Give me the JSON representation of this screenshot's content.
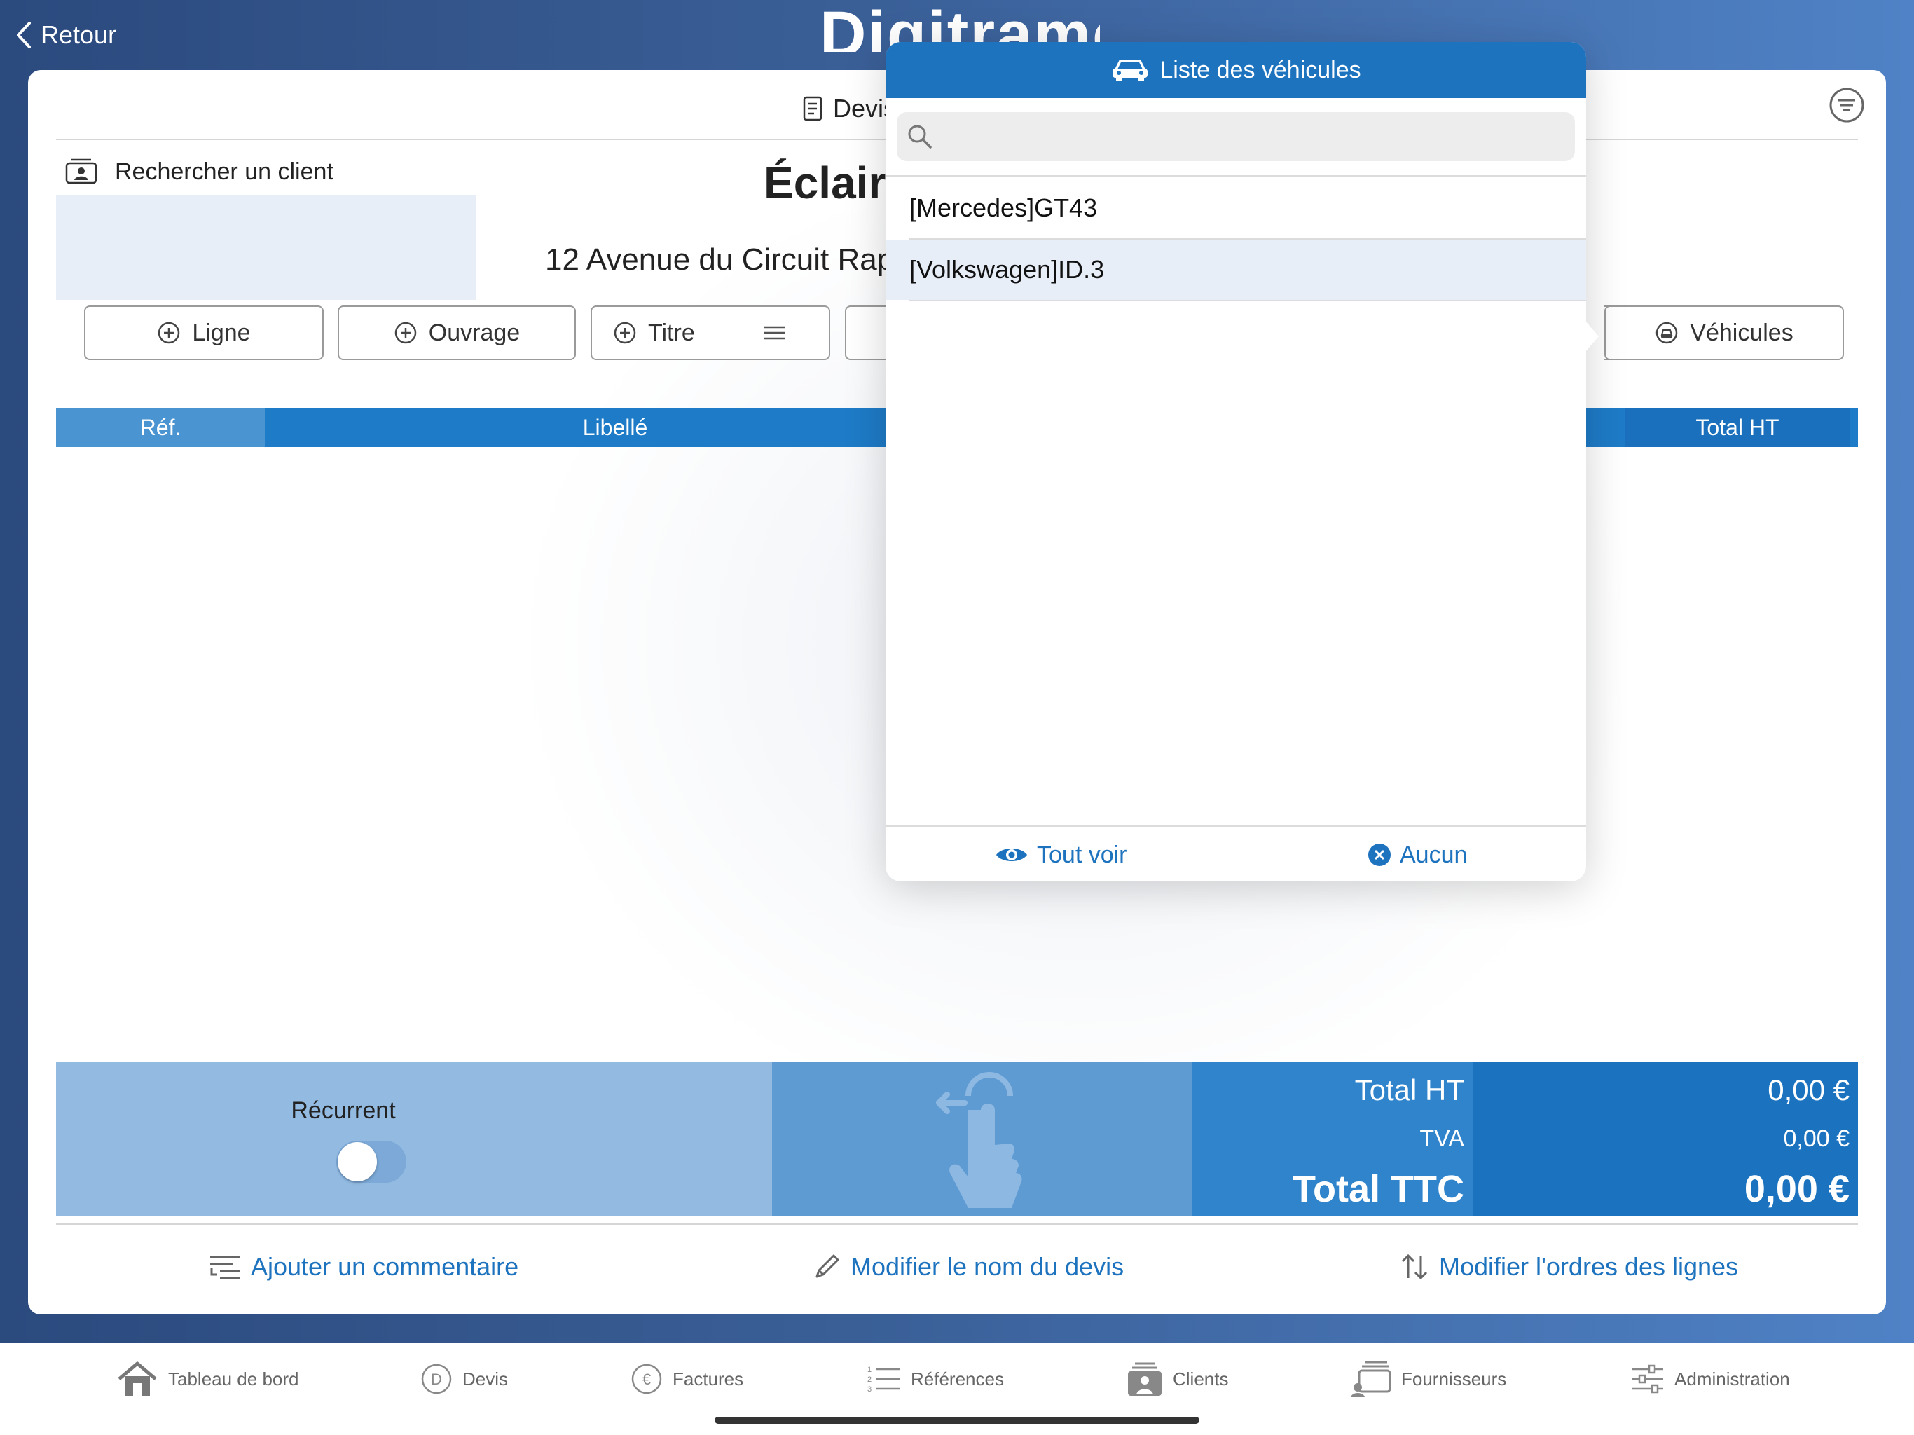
{
  "nav": {
    "back_label": "Retour"
  },
  "app": {
    "logo_text": "Digitrame"
  },
  "document": {
    "tab_title": "Devis",
    "client_search_label": "Rechercher un client",
    "company_name": "Éclair",
    "address": "12 Avenue du Circuit Rap"
  },
  "toolbar": {
    "ligne_label": "Ligne",
    "ouvrage_label": "Ouvrage",
    "titre_label": "Titre",
    "vehicules_label": "Véhicules"
  },
  "table": {
    "columns": [
      "Réf.",
      "Libellé",
      "Total HT"
    ]
  },
  "summary": {
    "recurrent_label": "Récurrent",
    "recurrent_on": false,
    "total_ht_label": "Total HT",
    "tva_label": "TVA",
    "total_ttc_label": "Total TTC",
    "total_ht_value": "0,00 €",
    "tva_value": "0,00 €",
    "total_ttc_value": "0,00 €"
  },
  "actions": {
    "add_comment": "Ajouter un commentaire",
    "rename": "Modifier le nom du devis",
    "reorder": "Modifier l'ordres des lignes"
  },
  "popover": {
    "title": "Liste des véhicules",
    "search_placeholder": "",
    "vehicles": [
      "[Mercedes]GT43",
      "[Volkswagen]ID.3"
    ],
    "selected_index": 1,
    "show_all_label": "Tout voir",
    "none_label": "Aucun"
  },
  "tabbar": {
    "items": [
      "Tableau de bord",
      "Devis",
      "Factures",
      "Références",
      "Clients",
      "Fournisseurs",
      "Administration"
    ]
  },
  "colors": {
    "accent": "#1e73be",
    "header_blue": "#1e7bc7",
    "selected_row": "#e8eef8"
  }
}
